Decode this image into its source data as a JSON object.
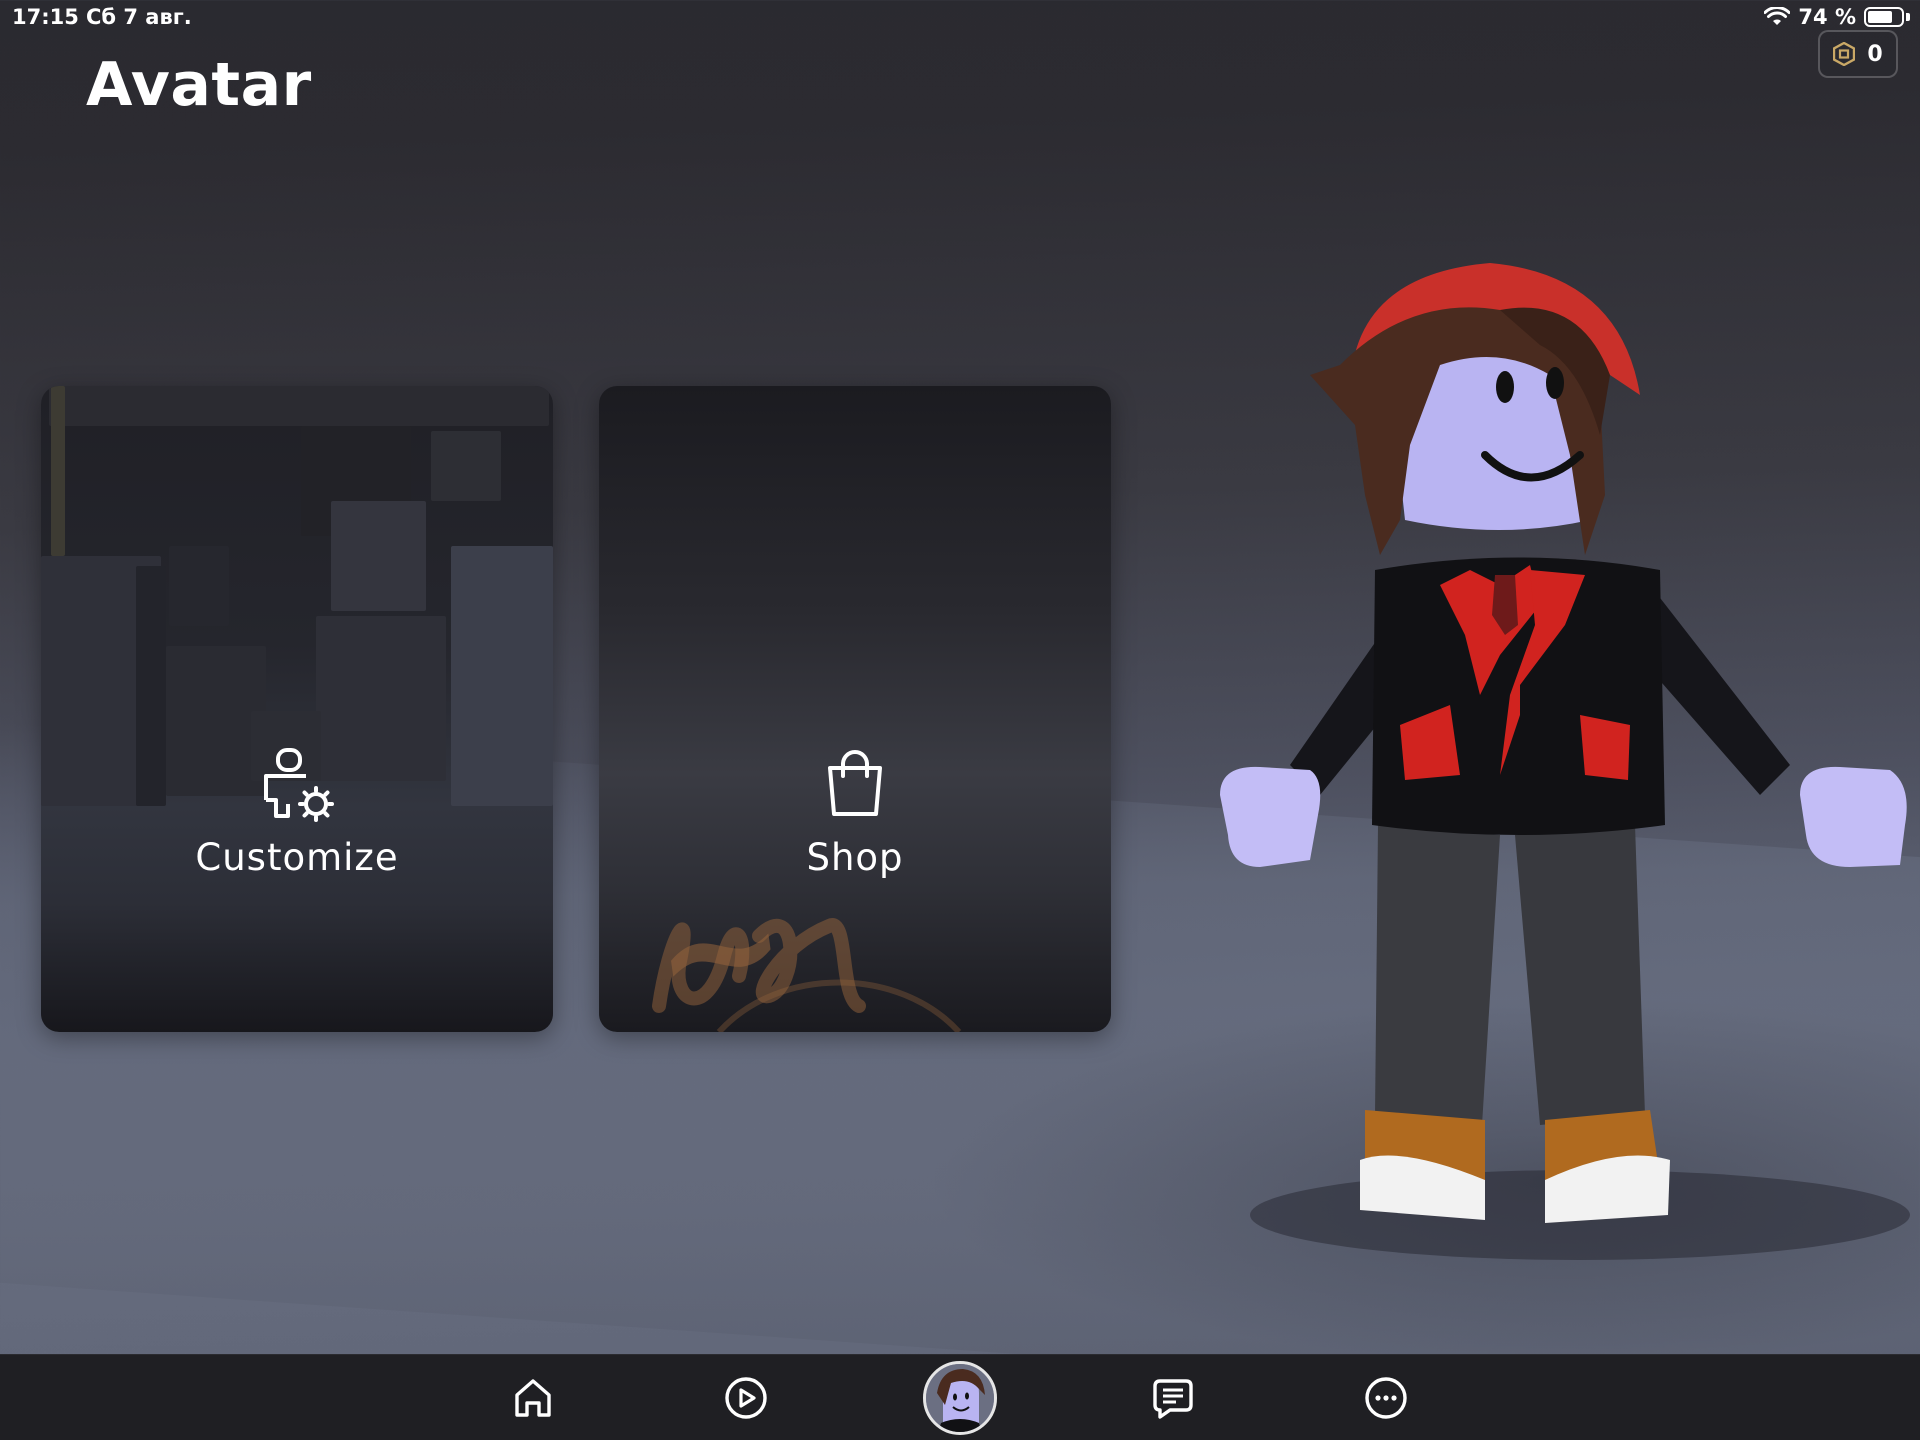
{
  "status_bar": {
    "time": "17:15",
    "date": "Сб 7 авг.",
    "battery_percent_label": "74 %",
    "battery_level": 0.74
  },
  "currency": {
    "icon": "robux-icon",
    "balance": "0"
  },
  "page": {
    "title": "Avatar"
  },
  "cards": {
    "customize": {
      "label": "Customize",
      "icon": "avatar-customize-icon"
    },
    "shop": {
      "label": "Shop",
      "icon": "shopping-bag-icon"
    }
  },
  "bottom_nav": {
    "items": [
      {
        "id": "home",
        "icon": "home-icon"
      },
      {
        "id": "play",
        "icon": "play-icon"
      },
      {
        "id": "avatar",
        "icon": "avatar-thumbnail"
      },
      {
        "id": "chat",
        "icon": "chat-icon"
      },
      {
        "id": "more",
        "icon": "more-icon"
      }
    ]
  },
  "colors": {
    "nav_background": "#1f1f23",
    "avatar_skin": "#b9b4f2",
    "avatar_hat": "#c9302a",
    "avatar_jacket": "#111114",
    "avatar_accent": "#d1231f"
  }
}
